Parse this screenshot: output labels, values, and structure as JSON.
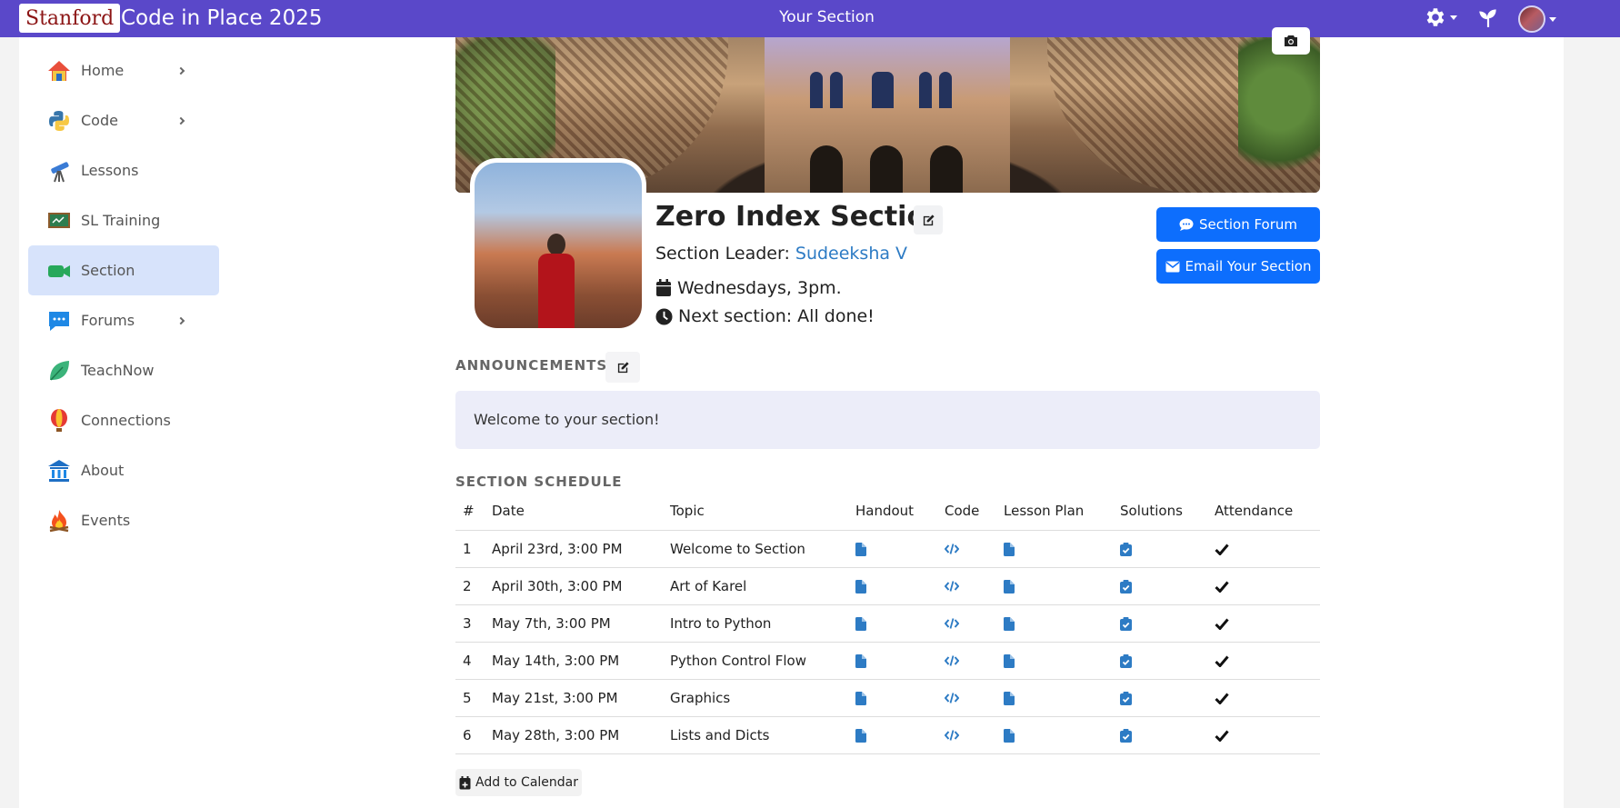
{
  "header": {
    "brand": "Stanford",
    "app_title": "Code in Place 2025",
    "page_title": "Your Section"
  },
  "sidebar": {
    "items": [
      {
        "label": "Home",
        "icon": "home-icon",
        "has_caret": true
      },
      {
        "label": "Code",
        "icon": "python-icon",
        "has_caret": true
      },
      {
        "label": "Lessons",
        "icon": "telescope-icon",
        "has_caret": false
      },
      {
        "label": "SL Training",
        "icon": "chalkboard-icon",
        "has_caret": false
      },
      {
        "label": "Section",
        "icon": "video-camera-icon",
        "has_caret": false,
        "active": true
      },
      {
        "label": "Forums",
        "icon": "chat-bubble-icon",
        "has_caret": true
      },
      {
        "label": "TeachNow",
        "icon": "leaf-icon",
        "has_caret": false
      },
      {
        "label": "Connections",
        "icon": "hot-air-balloon-icon",
        "has_caret": false
      },
      {
        "label": "About",
        "icon": "museum-icon",
        "has_caret": false
      },
      {
        "label": "Events",
        "icon": "campfire-icon",
        "has_caret": false
      }
    ]
  },
  "section": {
    "title": "Zero Index Section",
    "leader_prefix": "Section Leader:",
    "leader_name": "Sudeeksha V",
    "schedule_text": "Wednesdays, 3pm.",
    "next_section_text": "Next section: All done!",
    "forum_button": "Section Forum",
    "email_button": "Email Your Section"
  },
  "announcements": {
    "heading": "ANNOUNCEMENTS",
    "message": "Welcome to your section!"
  },
  "schedule": {
    "heading": "SECTION SCHEDULE",
    "columns": [
      "#",
      "Date",
      "Topic",
      "Handout",
      "Code",
      "Lesson Plan",
      "Solutions",
      "Attendance"
    ],
    "rows": [
      {
        "num": "1",
        "date": "April 23rd, 3:00 PM",
        "topic": "Welcome to Section"
      },
      {
        "num": "2",
        "date": "April 30th, 3:00 PM",
        "topic": "Art of Karel"
      },
      {
        "num": "3",
        "date": "May 7th, 3:00 PM",
        "topic": "Intro to Python"
      },
      {
        "num": "4",
        "date": "May 14th, 3:00 PM",
        "topic": "Python Control Flow"
      },
      {
        "num": "5",
        "date": "May 21st, 3:00 PM",
        "topic": "Graphics"
      },
      {
        "num": "6",
        "date": "May 28th, 3:00 PM",
        "topic": "Lists and Dicts"
      }
    ],
    "add_calendar_button": "Add to Calendar"
  },
  "colors": {
    "topbar": "#5a48c9",
    "primary_button": "#0d6efd",
    "link": "#2d7bc4",
    "brand_red": "#8c1515",
    "active_nav": "#d7e3fb"
  }
}
